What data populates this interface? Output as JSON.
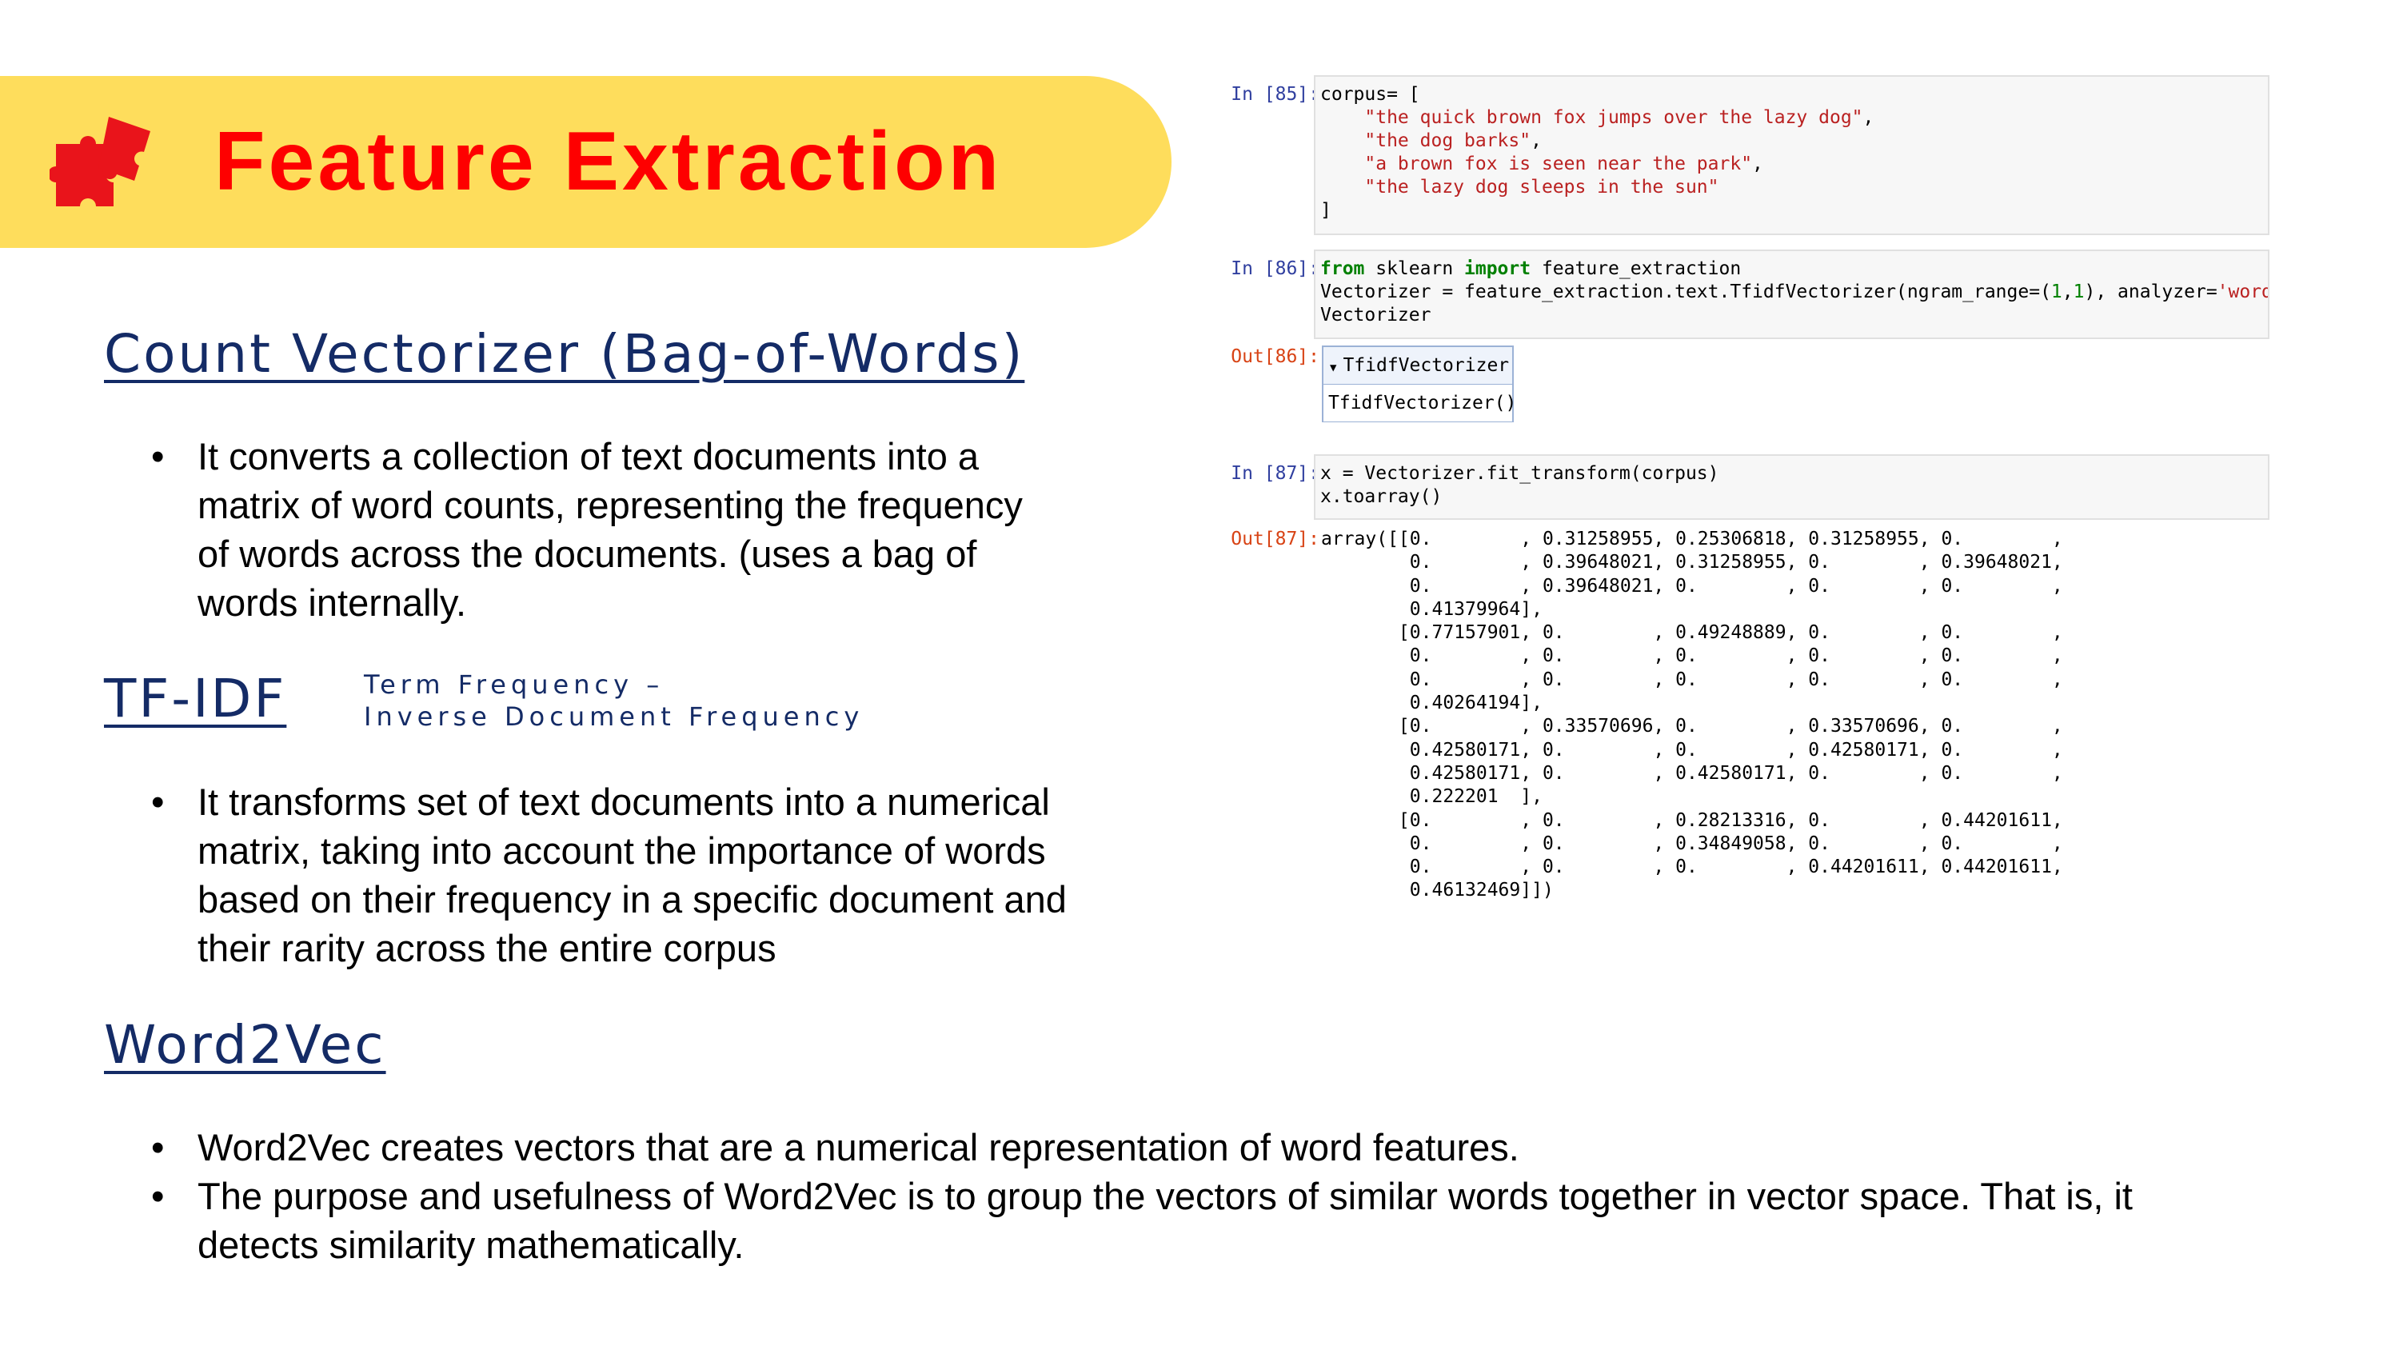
{
  "slide": {
    "title": "Feature Extraction",
    "colors": {
      "banner": "#FEDD5C",
      "title": "#FE0000",
      "heading": "#142B66"
    },
    "icon": "puzzle-icon"
  },
  "sections": {
    "count_vectorizer": {
      "heading": "Count Vectorizer (Bag-of-Words)",
      "bullets": [
        [
          "It converts a collection of text documents into a",
          "matrix of word counts, representing the frequency",
          "of words across the documents. (uses a bag of",
          "words internally."
        ]
      ]
    },
    "tfidf": {
      "heading": "TF-IDF",
      "sub_line1": "Term Frequency –",
      "sub_line2": "Inverse Document Frequency",
      "bullets": [
        [
          "It transforms set of text documents into a numerical",
          "matrix, taking into account the importance of words",
          "based on their frequency in a specific document and",
          "their rarity across the entire corpus"
        ]
      ]
    },
    "word2vec": {
      "heading": "Word2Vec",
      "bullets": [
        [
          "Word2Vec creates vectors that are a numerical representation of word features."
        ],
        [
          "The purpose and usefulness of Word2Vec is to group the vectors of similar words together in vector space. That is, it",
          "detects similarity mathematically."
        ]
      ]
    }
  },
  "notebook": {
    "cell85": {
      "prompt": "In [85]:",
      "lines": [
        [
          "corpus= ["
        ],
        [
          "    ",
          {
            "s": "\"the quick brown fox jumps over the lazy dog\""
          },
          ","
        ],
        [
          "    ",
          {
            "s": "\"the dog barks\""
          },
          ","
        ],
        [
          "    ",
          {
            "s": "\"a brown fox is seen near the park\""
          },
          ","
        ],
        [
          "    ",
          {
            "s": "\"the lazy dog sleeps in the sun\""
          }
        ],
        [
          "]"
        ]
      ]
    },
    "cell86": {
      "prompt": "In [86]:",
      "out_prompt": "Out[86]:",
      "lines": [
        [
          {
            "k": "from"
          },
          " sklearn ",
          {
            "k": "import"
          },
          " feature_extraction"
        ],
        [
          "Vectorizer = feature_extraction.text.TfidfVectorizer(ngram_range=(",
          {
            "n": "1"
          },
          ",",
          {
            "n": "1"
          },
          "), analyzer=",
          {
            "s": "'word'"
          },
          ")"
        ],
        [
          "Vectorizer"
        ]
      ],
      "widget_title": "TfidfVectorizer",
      "widget_body": "TfidfVectorizer()"
    },
    "cell87": {
      "prompt": "In [87]:",
      "out_prompt": "Out[87]:",
      "lines": [
        [
          "x = Vectorizer.fit_transform(corpus)"
        ],
        [
          "x.toarray()"
        ]
      ],
      "output_lines": [
        "array([[0.        , 0.31258955, 0.25306818, 0.31258955, 0.        ,",
        "        0.        , 0.39648021, 0.31258955, 0.        , 0.39648021,",
        "        0.        , 0.39648021, 0.        , 0.        , 0.        ,",
        "        0.41379964],",
        "       [0.77157901, 0.        , 0.49248889, 0.        , 0.        ,",
        "        0.        , 0.        , 0.        , 0.        , 0.        ,",
        "        0.        , 0.        , 0.        , 0.        , 0.        ,",
        "        0.40264194],",
        "       [0.        , 0.33570696, 0.        , 0.33570696, 0.        ,",
        "        0.42580171, 0.        , 0.        , 0.42580171, 0.        ,",
        "        0.42580171, 0.        , 0.42580171, 0.        , 0.        ,",
        "        0.222201  ],",
        "       [0.        , 0.        , 0.28213316, 0.        , 0.44201611,",
        "        0.        , 0.        , 0.34849058, 0.        , 0.        ,",
        "        0.        , 0.        , 0.        , 0.44201611, 0.44201611,",
        "        0.46132469]])"
      ]
    }
  }
}
